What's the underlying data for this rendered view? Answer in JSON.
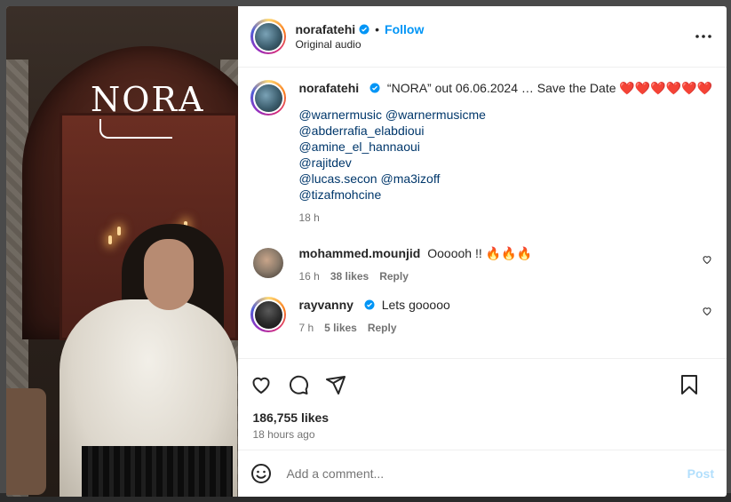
{
  "media": {
    "logo_text": "NORA",
    "mute_icon": "speaker-muted-icon"
  },
  "header": {
    "username": "norafatehi",
    "verified_icon": "verified-badge-icon",
    "separator": "•",
    "follow_label": "Follow",
    "audio_label": "Original audio",
    "more_icon": "more-options-icon"
  },
  "caption": {
    "username": "norafatehi",
    "text": "“NORA” out 06.06.2024 … Save the Date ❤️❤️❤️❤️❤️❤️",
    "mentions": [
      "@warnermusic @warnermusicme",
      "@abderrafia_elabdioui",
      "@amine_el_hannaoui",
      "@rajitdev",
      "@lucas.secon @ma3izoff",
      "@tizafmohcine"
    ],
    "time": "18 h"
  },
  "comments": [
    {
      "username": "mohammed.mounjid",
      "verified": false,
      "text": "Oooooh !! 🔥🔥🔥",
      "time": "16 h",
      "likes": "38 likes",
      "reply_label": "Reply",
      "avatar_color": "#8a7a6a"
    },
    {
      "username": "rayvanny",
      "verified": true,
      "text": "Lets gooooo",
      "time": "7 h",
      "likes": "5 likes",
      "reply_label": "Reply",
      "avatar_color": "#2a2a2a"
    }
  ],
  "actions": {
    "like_icon": "heart-icon",
    "comment_icon": "comment-icon",
    "share_icon": "share-icon",
    "save_icon": "bookmark-icon"
  },
  "likes_count": "186,755 likes",
  "posted_time": "18 hours ago",
  "comment_box": {
    "emoji_icon": "emoji-icon",
    "placeholder": "Add a comment...",
    "post_label": "Post"
  },
  "colors": {
    "accent_blue": "#0095f6",
    "post_disabled": "#b2dffc",
    "mention": "#00376b",
    "muted_text": "#737373"
  }
}
